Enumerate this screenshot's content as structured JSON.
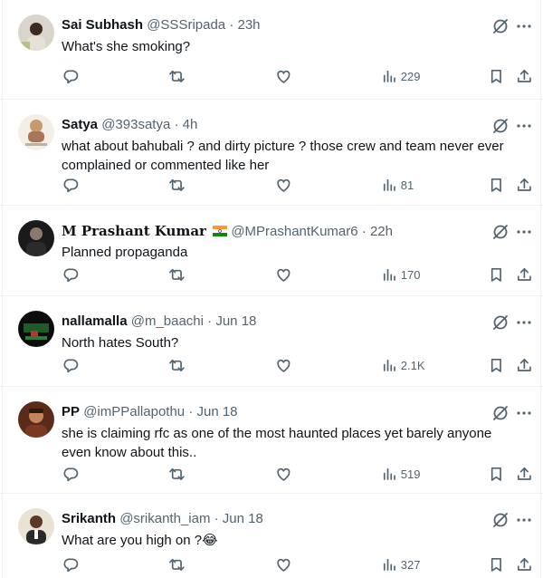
{
  "colors": {
    "text": "#0f1419",
    "muted": "#536471",
    "divider": "#eff3f4"
  },
  "icons": [
    "grok-icon",
    "more-icon",
    "reply-icon",
    "retweet-icon",
    "like-icon",
    "views-icon",
    "bookmark-icon",
    "share-icon"
  ],
  "tweets": [
    {
      "name": "Sai Subhash",
      "handle": "@SSSripada",
      "sep": "·",
      "time": "23h",
      "text": "What's she smoking?",
      "views": "229"
    },
    {
      "name": "Satya",
      "handle": "@393satya",
      "sep": "·",
      "time": "4h",
      "text": "what about bahubali ? and dirty picture ? those crew and team never ever complained or commented like her",
      "views": "81"
    },
    {
      "name": "M Prashant Kumar",
      "handle": "@MPrashantKumar6",
      "sep": "·",
      "time": "22h",
      "text": "Planned propaganda",
      "views": "170"
    },
    {
      "name": "nallamalla",
      "handle": "@m_baachi",
      "sep": "·",
      "time": "Jun 18",
      "text": "North hates South?",
      "views": "2.1K"
    },
    {
      "name": "PP",
      "handle": "@imPPallapothu",
      "sep": "·",
      "time": "Jun 18",
      "text": "she is claiming rfc as one of the most haunted places yet barely anyone even know about this..",
      "views": "519"
    },
    {
      "name": "Srikanth",
      "handle": "@srikanth_iam",
      "sep": "·",
      "time": "Jun 18",
      "text": "What are you high on ?😂",
      "views": "327"
    }
  ]
}
